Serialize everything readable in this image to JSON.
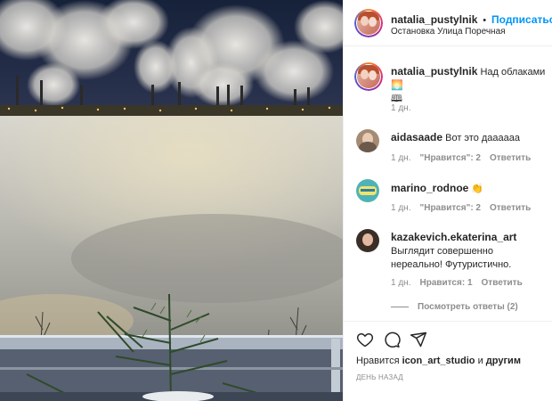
{
  "header": {
    "username": "natalia_pustylnik",
    "separator": "•",
    "follow": "Подписаться",
    "location": "Остановка Улица Поречная"
  },
  "caption": {
    "username": "natalia_pustylnik",
    "text": "Над облаками",
    "emoji_1": "🌅",
    "emoji_2": "🕮",
    "time": "1 дн."
  },
  "comments": [
    {
      "username": "aidasaade",
      "text": "Вот это даааааа",
      "time": "1 дн.",
      "likes": "\"Нравится\": 2",
      "reply": "Ответить"
    },
    {
      "username": "marino_rodnoe",
      "text": "👏",
      "time": "1 дн.",
      "likes": "\"Нравится\": 2",
      "reply": "Ответить"
    },
    {
      "username": "kazakevich.ekaterina_art",
      "text": "Выглядит совершенно нереально! Футуристично.",
      "time": "1 дн.",
      "likes": "Нравится: 1",
      "reply": "Ответить"
    }
  ],
  "view_replies": "Посмотреть ответы (2)",
  "actions": {
    "like_icon": "heart-icon",
    "comment_icon": "comment-icon",
    "share_icon": "share-icon"
  },
  "likes_line": {
    "prefix": "Нравится",
    "user": "icon_art_studio",
    "middle": "и",
    "others": "другим"
  },
  "posted": "ДЕНЬ НАЗАД",
  "colors": {
    "follow_blue": "#0095f6",
    "text": "#262626",
    "muted": "#8e8e8e"
  }
}
